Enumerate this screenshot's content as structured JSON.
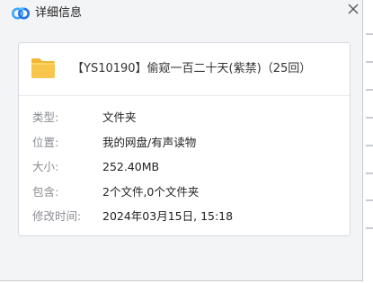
{
  "window": {
    "title": "详细信息",
    "close_glyph": "×"
  },
  "file": {
    "name": "【YS10190】偷窥一百二十天(紫禁)（25回）",
    "icon": "folder-icon"
  },
  "details": [
    {
      "label": "类型:",
      "value": "文件夹"
    },
    {
      "label": "位置:",
      "value": "我的网盘/有声读物"
    },
    {
      "label": "大小:",
      "value": "252.40MB"
    },
    {
      "label": "包含:",
      "value": "2个文件,0个文件夹"
    },
    {
      "label": "修改时间:",
      "value": "2024年03月15日, 15:18"
    }
  ],
  "colors": {
    "background": "#f3f4f6",
    "card": "#ffffff",
    "label": "#8a8d93",
    "value": "#222222",
    "folder": "#f7c64b"
  }
}
